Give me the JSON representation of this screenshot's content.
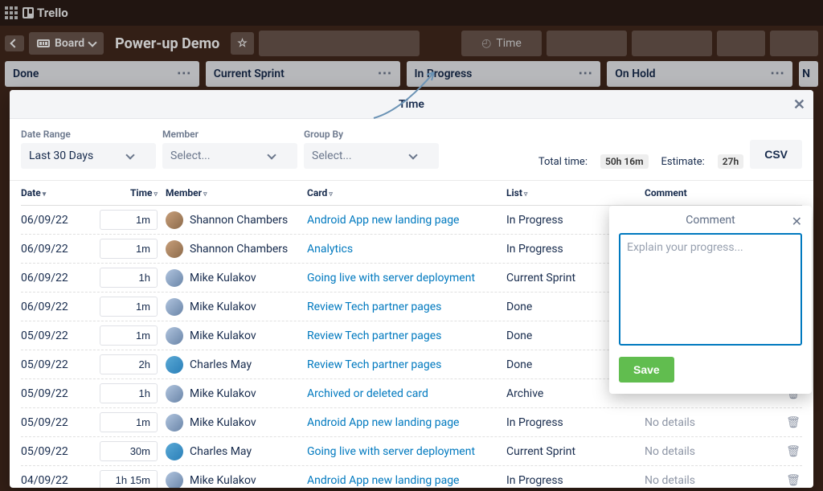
{
  "app": {
    "brand": "Trello"
  },
  "board_header": {
    "board_label": "Board",
    "title": "Power-up Demo",
    "time_btn": "Time"
  },
  "lists": [
    {
      "title": "Done"
    },
    {
      "title": "Current Sprint"
    },
    {
      "title": "In Progress"
    },
    {
      "title": "On Hold"
    },
    {
      "title": "N"
    }
  ],
  "time_modal": {
    "title": "Time",
    "filters": {
      "date_range": {
        "label": "Date Range",
        "value": "Last 30 Days"
      },
      "member": {
        "label": "Member",
        "placeholder": "Select..."
      },
      "group_by": {
        "label": "Group By",
        "placeholder": "Select..."
      }
    },
    "totals": {
      "total_label": "Total time:",
      "total_value": "50h 16m",
      "estimate_label": "Estimate:",
      "estimate_value": "27h"
    },
    "csv_btn": "CSV",
    "columns": {
      "date": "Date",
      "time": "Time",
      "member": "Member",
      "card": "Card",
      "list": "List",
      "comment": "Comment"
    },
    "rows": [
      {
        "date": "06/09/22",
        "time": "1m",
        "member": "Shannon Chambers",
        "avatar": "a1",
        "card": "Android App new landing page",
        "list": "In Progress",
        "comment": ""
      },
      {
        "date": "06/09/22",
        "time": "1m",
        "member": "Shannon Chambers",
        "avatar": "a1",
        "card": "Analytics",
        "list": "In Progress",
        "comment": ""
      },
      {
        "date": "06/09/22",
        "time": "1h",
        "member": "Mike Kulakov",
        "avatar": "a2",
        "card": "Going live with server deployment",
        "list": "Current Sprint",
        "comment": ""
      },
      {
        "date": "06/09/22",
        "time": "1m",
        "member": "Mike Kulakov",
        "avatar": "a2",
        "card": "Review Tech partner pages",
        "list": "Done",
        "comment": ""
      },
      {
        "date": "05/09/22",
        "time": "1m",
        "member": "Mike Kulakov",
        "avatar": "a2",
        "card": "Review Tech partner pages",
        "list": "Done",
        "comment": ""
      },
      {
        "date": "05/09/22",
        "time": "2h",
        "member": "Charles May",
        "avatar": "a3",
        "card": "Review Tech partner pages",
        "list": "Done",
        "comment": ""
      },
      {
        "date": "05/09/22",
        "time": "1h",
        "member": "Mike Kulakov",
        "avatar": "a2",
        "card": "Archived or deleted card",
        "list": "Archive",
        "comment": ""
      },
      {
        "date": "05/09/22",
        "time": "1m",
        "member": "Mike Kulakov",
        "avatar": "a2",
        "card": "Android App new landing page",
        "list": "In Progress",
        "comment": "No details"
      },
      {
        "date": "05/09/22",
        "time": "30m",
        "member": "Charles May",
        "avatar": "a3",
        "card": "Going live with server deployment",
        "list": "Current Sprint",
        "comment": "No details"
      },
      {
        "date": "04/09/22",
        "time": "1h 15m",
        "member": "Mike Kulakov",
        "avatar": "a2",
        "card": "Android App new landing page",
        "list": "In Progress",
        "comment": "No details"
      }
    ]
  },
  "comment_popover": {
    "title": "Comment",
    "placeholder": "Explain your progress...",
    "save": "Save"
  }
}
